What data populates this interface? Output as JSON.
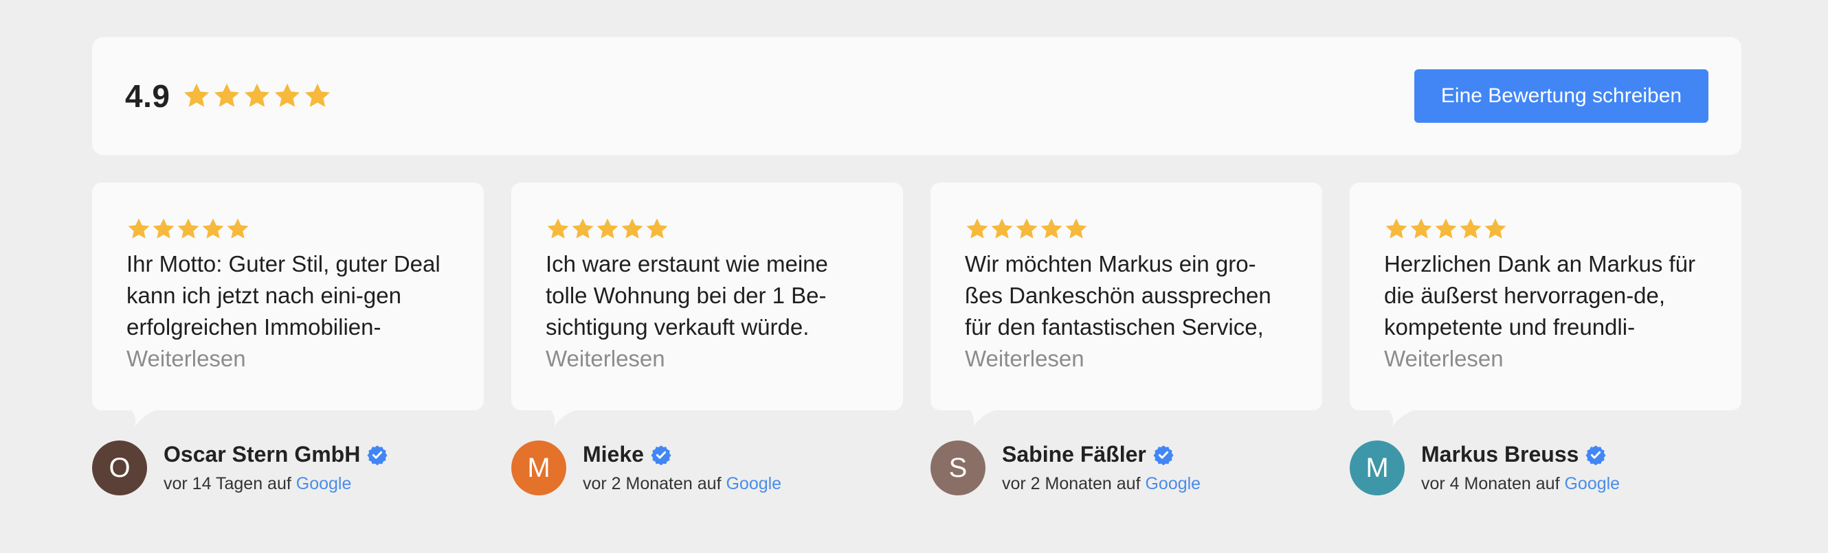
{
  "summary": {
    "rating": "4.9",
    "stars": 5,
    "star_color": "#f6b93b",
    "write_button_label": "Eine Bewertung schreiben",
    "button_color": "#4286f5"
  },
  "reviews": [
    {
      "stars": 5,
      "text": "Ihr Motto: Guter Stil, guter Deal kann ich jetzt nach eini-gen erfolgreichen Immobilien-",
      "read_more": "Weiterlesen",
      "author": "Oscar Stern GmbH",
      "initial": "O",
      "avatar_color": "#5b4038",
      "time": "vor 14 Tagen auf",
      "source": "Google"
    },
    {
      "stars": 5,
      "text": "Ich ware erstaunt wie meine tolle Wohnung bei der 1 Be-sichtigung verkauft würde.",
      "read_more": "Weiterlesen",
      "author": "Mieke",
      "initial": "M",
      "avatar_color": "#e4722b",
      "time": "vor 2 Monaten auf",
      "source": "Google"
    },
    {
      "stars": 5,
      "text": "Wir möchten Markus ein gro-ßes Dankeschön aussprechen für den fantastischen Service,",
      "read_more": "Weiterlesen",
      "author": "Sabine Fäßler",
      "initial": "S",
      "avatar_color": "#8a6f66",
      "time": "vor 2 Monaten auf",
      "source": "Google"
    },
    {
      "stars": 5,
      "text": "Herzlichen Dank an Markus für die äußerst hervorragen-de, kompetente und freundli-",
      "read_more": "Weiterlesen",
      "author": "Markus Breuss",
      "initial": "M",
      "avatar_color": "#3d97a8",
      "time": "vor 4 Monaten auf",
      "source": "Google"
    }
  ]
}
